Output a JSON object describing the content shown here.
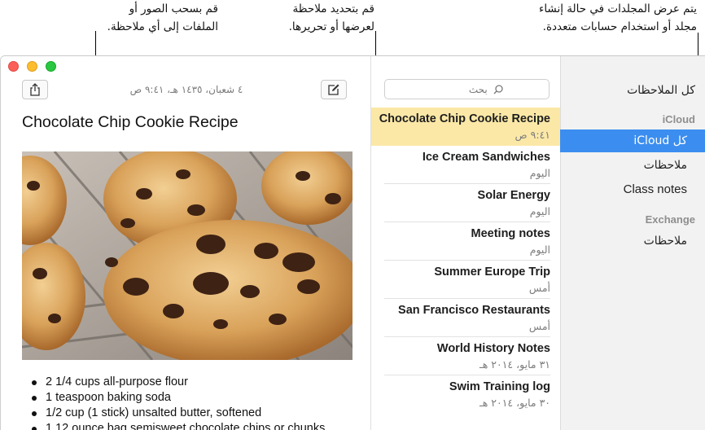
{
  "callouts": {
    "left": [
      "قم بسحب الصور أو",
      "الملفات إلى أي ملاحظة."
    ],
    "middle": [
      "قم بتحديد ملاحظة",
      "لعرضها أو تحريرها."
    ],
    "right": [
      "يتم عرض المجلدات في حالة إنشاء",
      "مجلد أو استخدام حسابات متعددة."
    ]
  },
  "sidebar": {
    "all_notes": "كل الملاحظات",
    "sections": [
      {
        "title": "iCloud",
        "items": [
          {
            "label": "كل iCloud",
            "selected": true
          },
          {
            "label": "ملاحظات",
            "selected": false
          },
          {
            "label": "Class notes",
            "selected": false
          }
        ]
      },
      {
        "title": "Exchange",
        "items": [
          {
            "label": "ملاحظات",
            "selected": false
          }
        ]
      }
    ]
  },
  "search": {
    "placeholder": "بحث",
    "icon": "magnifier-icon"
  },
  "notes": [
    {
      "title": "Chocolate Chip Cookie Recipe",
      "date": "٩:٤١ ص",
      "selected": true
    },
    {
      "title": "Ice Cream Sandwiches",
      "date": "اليوم",
      "selected": false
    },
    {
      "title": "Solar Energy",
      "date": "اليوم",
      "selected": false
    },
    {
      "title": "Meeting notes",
      "date": "اليوم",
      "selected": false
    },
    {
      "title": "Summer Europe Trip",
      "date": "أمس",
      "selected": false
    },
    {
      "title": "San Francisco Restaurants",
      "date": "أمس",
      "selected": false
    },
    {
      "title": "World History Notes",
      "date": "٣١ مايو، ٢٠١٤ هـ",
      "selected": false
    },
    {
      "title": "Swim Training log",
      "date": "٣٠ مايو، ٢٠١٤ هـ",
      "selected": false
    }
  ],
  "editor": {
    "date": "٤ شعبان، ١٤٣٥ هـ، ٩:٤١ ص",
    "title": "Chocolate Chip Cookie Recipe",
    "ingredients": [
      "2 1/4 cups all-purpose flour",
      "1 teaspoon baking soda",
      "1/2 cup (1 stick) unsalted butter, softened",
      "1 12 ounce bag semisweet chocolate chips or chunks"
    ]
  },
  "colors": {
    "selected_folder": "#3b8ef0",
    "selected_note": "#fbe8a7",
    "close": "#fc5f57",
    "minimize": "#fdbd2e",
    "zoom": "#29c840"
  }
}
